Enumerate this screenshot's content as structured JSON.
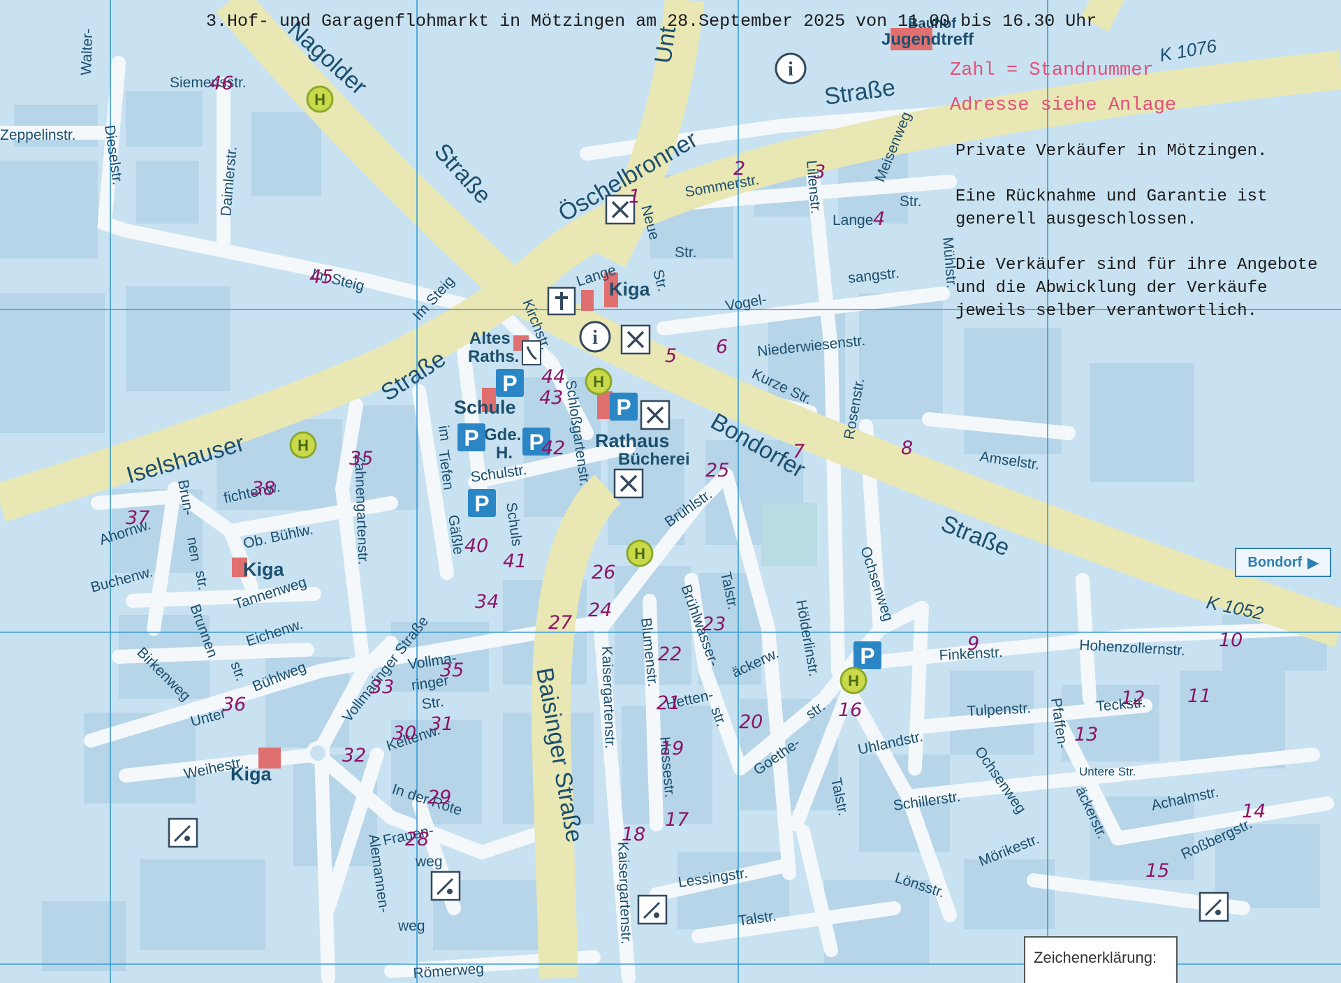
{
  "header": {
    "title": "3.Hof- und Garagenflohmarkt in Mötzingen am 28.September 2025 von 11.00 bis 16.30 Uhr"
  },
  "notes": {
    "line1": "Zahl = Standnummer",
    "line2": "Adresse siehe Anlage",
    "p1": "Private Verkäufer in Mötzingen.",
    "p2": "Eine Rücknahme und Garantie ist generell ausgeschlossen.",
    "p3": "Die Verkäufer sind für ihre Angebote und die Abwicklung der Verkäufe jeweils selber verantwortlich."
  },
  "colors": {
    "map_bg": "#c9e2f1",
    "road": "#f4f8fb",
    "main_road": "#e9e7b4",
    "block": "#b5d4e8",
    "grid": "#3a9bd4",
    "stand_marker": "#8d1466",
    "poi_red": "#e07070",
    "parking_blue": "#2b86c5",
    "bus_yellow": "#c9d94a"
  },
  "roads": {
    "nagolder_a": "Nagolder",
    "nagolder_b": "Straße",
    "oeschelbronner": "Öschelbronner",
    "oeschel_strasse": "Straße",
    "iselshauser": "Iselshauser",
    "iselshauser_b": "Straße",
    "bondorfer": "Bondorfer",
    "bondorfer_b": "Straße",
    "baisinger": "Baisinger Straße",
    "k1076": "K 1076",
    "k1052": "K 1052",
    "unt": "Unt"
  },
  "streets": {
    "walter": "Walter-",
    "siemens": "Siemensstr.",
    "zeppelin": "Zeppelinstr.",
    "diesel": "Dieselstr.",
    "daimler": "Daimlerstr.",
    "steig": "Im Steig",
    "im_steig": "Im Steig",
    "sommer": "Sommerstr.",
    "lilien": "Lilienstr.",
    "meisen": "Meisenweg",
    "lange1": "Lange",
    "lange2": "Str.",
    "neue": "Neue",
    "neue_str": "Str.",
    "str": "Str.",
    "lange_n": "Lange",
    "kirch": "Kirchstr.",
    "vogel": "Vogel-",
    "sang": "sangstr.",
    "muehl": "Mühlstr.",
    "niederwiesen": "Niederwiesenstr.",
    "kurze": "Kurze Str.",
    "rosen": "Rosenstr.",
    "amsel": "Amselstr.",
    "schlossgarten": "Schloßgartenstr.",
    "tiefen1": "im",
    "tiefen2": "Tiefen",
    "schul": "Schulstr.",
    "schuls": "Schuls",
    "gaessle": "Gäßle",
    "bruehl": "Brühlstr.",
    "zahnengarten": "Zahnengartenstr.",
    "ahorn": "Ahornw.",
    "brunnen1": "Brun-",
    "brunnen2": "nen",
    "brunnen3": "str.",
    "fichten": "fichtenw.",
    "ob_buehl": "Ob. Bühlw.",
    "buchen": "Buchenw.",
    "tannen": "Tannenweg",
    "brunnen_b": "Brunnen",
    "brunnen_b2": "str.",
    "eichen": "Eichenw.",
    "birken": "Birkenweg",
    "buehlweg": "Bühlweg",
    "unterer": "Unter",
    "weihe": "Weihestr.",
    "vollmaringer": "Vollmaringer Straße",
    "vollma1": "Vollma-",
    "vollma2": "ringer",
    "vollma3": "Str.",
    "kelten": "Keltenw.",
    "roete": "In der Röte",
    "frauen1": "Frauen-",
    "frauen2": "weg",
    "alemannen1": "Alemannen-",
    "alemannen2": "weg",
    "roemer": "Römerweg",
    "kaisergarten": "Kaisergartenstr.",
    "kaisergarten2": "Kaisergartenstr.",
    "blumen": "Blumenstr.",
    "bruehlwasser": "Brühlwasser-",
    "bruehlwasser2": "str.",
    "tal": "Talstr.",
    "tal2": "Talstr.",
    "tal3": "Talstr.",
    "hessest": "Hessestr.",
    "hetten": "Hetten-",
    "aeckerw": "äckerw.",
    "goethe": "Goethe-",
    "goethe2": "str.",
    "hoelderlin": "Hölderlinstr.",
    "ochsenweg": "Ochsenweg",
    "ochsenweg2": "Ochsenweg",
    "finken": "Finkenstr.",
    "hohenzollern": "Hohenzollernstr.",
    "tulpen": "Tulpenstr.",
    "pfaffen": "Pfaffen-",
    "aeckerstr": "äckerstr.",
    "teck": "Teckstr.",
    "untere": "Untere Str.",
    "uhland": "Uhlandstr.",
    "schiller": "Schillerstr.",
    "moerike": "Mörikestr.",
    "achalm": "Achalmstr.",
    "rossberg": "Roßbergstr.",
    "lessing": "Lessingstr.",
    "loens": "Lönsstr."
  },
  "buildings": {
    "altes_raths": "Altes",
    "altes_raths2": "Raths.",
    "schule": "Schule",
    "gde_h1": "Gde.",
    "gde_h2": "H.",
    "rathaus": "Rathaus",
    "buecherei": "Bücherei",
    "kiga": "Kiga",
    "jugendtreff": "Jugendtreff",
    "bauhof": "Bauhof"
  },
  "icons": {
    "parking": "P",
    "bus": "H",
    "info": "i",
    "church": "church-cross-icon",
    "restaurant": "restaurant-icon",
    "phone": "phone-icon",
    "sport": "sports-field-icon"
  },
  "bondorf_button": {
    "label": "Bondorf",
    "arrow": "▶"
  },
  "legend": {
    "title": "Zeichenerklärung:"
  },
  "stands": [
    {
      "n": "1"
    },
    {
      "n": "2"
    },
    {
      "n": "3"
    },
    {
      "n": "4"
    },
    {
      "n": "5"
    },
    {
      "n": "6"
    },
    {
      "n": "7"
    },
    {
      "n": "8"
    },
    {
      "n": "9"
    },
    {
      "n": "10"
    },
    {
      "n": "11"
    },
    {
      "n": "12"
    },
    {
      "n": "13"
    },
    {
      "n": "14"
    },
    {
      "n": "15"
    },
    {
      "n": "16"
    },
    {
      "n": "17"
    },
    {
      "n": "18"
    },
    {
      "n": "19"
    },
    {
      "n": "20"
    },
    {
      "n": "21"
    },
    {
      "n": "22"
    },
    {
      "n": "23"
    },
    {
      "n": "24"
    },
    {
      "n": "25"
    },
    {
      "n": "26"
    },
    {
      "n": "27"
    },
    {
      "n": "28"
    },
    {
      "n": "29"
    },
    {
      "n": "30"
    },
    {
      "n": "31"
    },
    {
      "n": "32"
    },
    {
      "n": "33"
    },
    {
      "n": "34"
    },
    {
      "n": "35"
    },
    {
      "n": "35"
    },
    {
      "n": "36"
    },
    {
      "n": "37"
    },
    {
      "n": "38"
    },
    {
      "n": "40"
    },
    {
      "n": "41"
    },
    {
      "n": "42"
    },
    {
      "n": "43"
    },
    {
      "n": "44"
    },
    {
      "n": "45"
    },
    {
      "n": "46"
    }
  ]
}
